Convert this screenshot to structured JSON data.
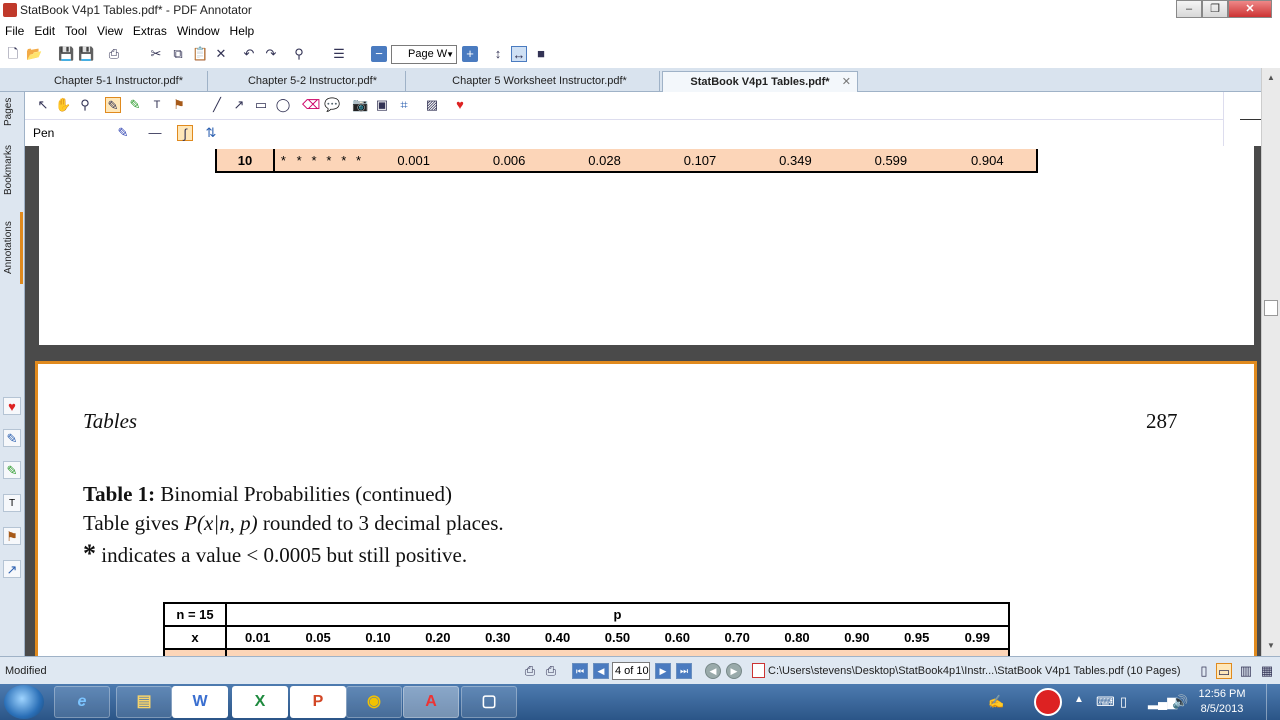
{
  "window": {
    "title": "StatBook V4p1 Tables.pdf* - PDF Annotator"
  },
  "menu": [
    "File",
    "Edit",
    "Tool",
    "View",
    "Extras",
    "Window",
    "Help"
  ],
  "toolbar": {
    "zoom_value": "Page W"
  },
  "tabs": [
    {
      "label": "Chapter 5-1 Instructor.pdf*"
    },
    {
      "label": "Chapter 5-2 Instructor.pdf*"
    },
    {
      "label": "Chapter 5 Worksheet Instructor.pdf*"
    },
    {
      "label": "StatBook V4p1 Tables.pdf*",
      "close": "✕"
    }
  ],
  "side_tabs": [
    "Pages",
    "Bookmarks",
    "Annotations"
  ],
  "annotation_bar": {
    "tool_name": "Pen"
  },
  "page_top": {
    "row_label": "10",
    "cells": [
      "*",
      "*",
      "*",
      "*",
      "*",
      "*",
      "0.001",
      "0.006",
      "0.028",
      "0.107",
      "0.349",
      "0.599",
      "0.904"
    ]
  },
  "page_bottom": {
    "header_left": "Tables",
    "page_number": "287",
    "caption_bold": "Table 1:",
    "caption_rest": "Binomial Probabilities (continued)",
    "line2_pre": "Table gives ",
    "line2_math": "P(x|n, p)",
    "line2_post": " rounded to 3 decimal places.",
    "line3_star": "*",
    "line3_rest": " indicates a value < 0.0005 but still positive.",
    "table": {
      "n_label": "n = 15",
      "p_label": "p",
      "x_label": "x",
      "p_values": [
        "0.01",
        "0.05",
        "0.10",
        "0.20",
        "0.30",
        "0.40",
        "0.50",
        "0.60",
        "0.70",
        "0.80",
        "0.90",
        "0.95",
        "0.99"
      ]
    }
  },
  "status": {
    "left": "Modified",
    "page_indicator": "4 of 10",
    "path": "C:\\Users\\stevens\\Desktop\\StatBook4p1\\Instr...\\StatBook V4p1 Tables.pdf (10 Pages)"
  },
  "taskbar": {
    "time": "12:56 PM",
    "date": "8/5/2013",
    "apps": [
      "e",
      "▤",
      "W",
      "X",
      "P",
      "◉",
      "A",
      "▢"
    ]
  },
  "colors": {
    "highlight_row": "#fcd5b8",
    "page_border_active": "#e08a1e",
    "ui_blue": "#dde6f0"
  }
}
